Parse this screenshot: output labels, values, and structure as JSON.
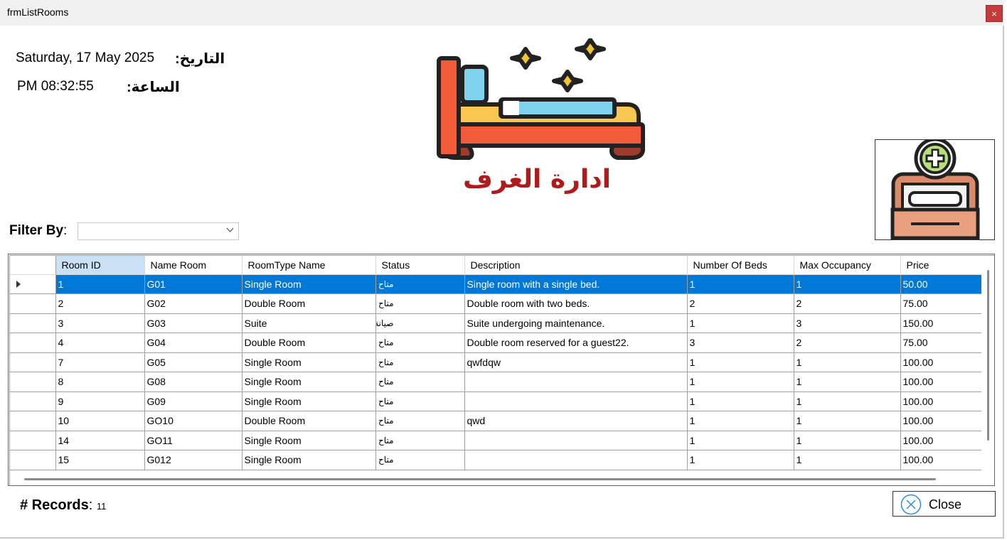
{
  "window": {
    "title": "frmListRooms",
    "close_glyph": "×"
  },
  "header": {
    "date_label": "التاريخ:",
    "date_value": "Saturday, 17 May 2025",
    "time_label": "الساعة:",
    "time_value": "PM 08:32:55",
    "page_title": "ادارة الغرف",
    "title_color": "#b01a1a"
  },
  "icons": {
    "main": "bed-icon",
    "add": "add-room-icon",
    "close": "close-circle-icon"
  },
  "filter": {
    "label": "Filter By",
    "colon": ":",
    "selected": ""
  },
  "grid": {
    "columns": [
      "Room ID",
      "Name Room",
      "RoomType Name",
      "Status",
      "Description",
      "Number Of Beds",
      "Max Occupancy",
      "Price"
    ],
    "rows": [
      [
        "1",
        "G01",
        "Single Room",
        "متاح",
        "Single room with a single bed.",
        "1",
        "1",
        "50.00"
      ],
      [
        "2",
        "G02",
        "Double Room",
        "متاح",
        "Double room with two beds.",
        "2",
        "2",
        "75.00"
      ],
      [
        "3",
        "G03",
        "Suite",
        "صيانة",
        "Suite undergoing maintenance.",
        "1",
        "3",
        "150.00"
      ],
      [
        "4",
        "G04",
        "Double Room",
        "متاح",
        "Double room reserved for a guest22.",
        "3",
        "2",
        "75.00"
      ],
      [
        "7",
        "G05",
        "Single Room",
        "متاح",
        "qwfdqw",
        "1",
        "1",
        "100.00"
      ],
      [
        "8",
        "G08",
        "Single Room",
        "متاح",
        "",
        "1",
        "1",
        "100.00"
      ],
      [
        "9",
        "G09",
        "Single Room",
        "متاح",
        "",
        "1",
        "1",
        "100.00"
      ],
      [
        "10",
        "GO10",
        "Double Room",
        "متاح",
        "qwd",
        "1",
        "1",
        "100.00"
      ],
      [
        "14",
        "GO11",
        "Single Room",
        "متاح",
        "",
        "1",
        "1",
        "100.00"
      ],
      [
        "15",
        "G012",
        "Single Room",
        "متاح",
        "",
        "1",
        "1",
        "100.00"
      ]
    ],
    "selected_row": 0,
    "selection_color": "#0078d7"
  },
  "footer": {
    "records_label": "# Records",
    "records_colon": ":",
    "records_count": "11",
    "close_label": "Close"
  }
}
